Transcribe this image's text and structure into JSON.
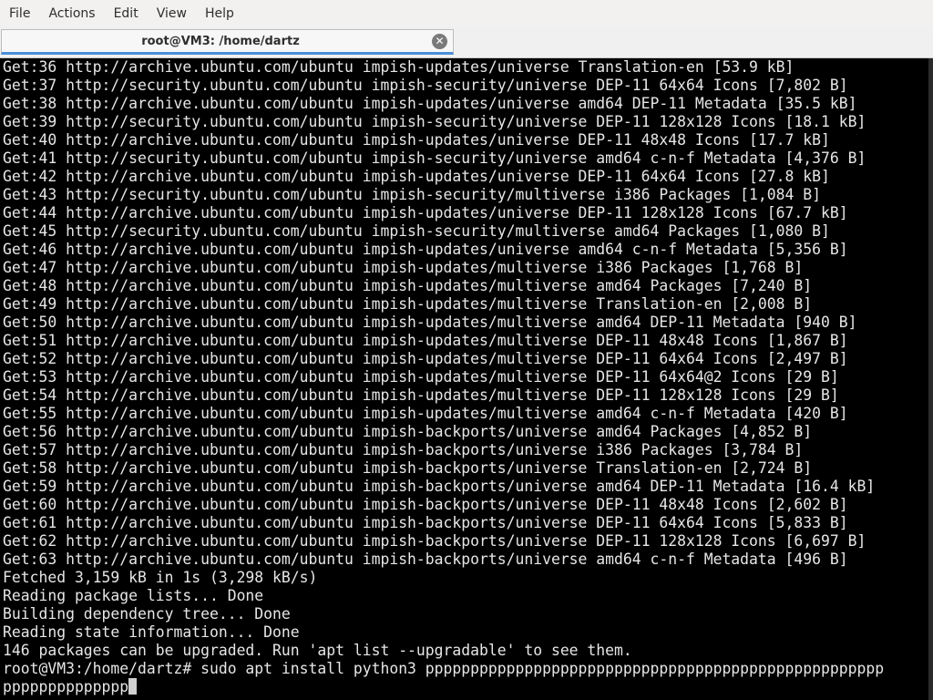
{
  "menubar": {
    "items": [
      "File",
      "Actions",
      "Edit",
      "View",
      "Help"
    ]
  },
  "tab": {
    "title": "root@VM3: /home/dartz",
    "close_icon": "close-icon"
  },
  "terminal": {
    "background": "#000000",
    "foreground": "#e6e6e6",
    "lines": [
      "Get:36 http://archive.ubuntu.com/ubuntu impish-updates/universe Translation-en [53.9 kB]",
      "Get:37 http://security.ubuntu.com/ubuntu impish-security/universe DEP-11 64x64 Icons [7,802 B]",
      "Get:38 http://archive.ubuntu.com/ubuntu impish-updates/universe amd64 DEP-11 Metadata [35.5 kB]",
      "Get:39 http://security.ubuntu.com/ubuntu impish-security/universe DEP-11 128x128 Icons [18.1 kB]",
      "Get:40 http://archive.ubuntu.com/ubuntu impish-updates/universe DEP-11 48x48 Icons [17.7 kB]",
      "Get:41 http://security.ubuntu.com/ubuntu impish-security/universe amd64 c-n-f Metadata [4,376 B]",
      "Get:42 http://archive.ubuntu.com/ubuntu impish-updates/universe DEP-11 64x64 Icons [27.8 kB]",
      "Get:43 http://security.ubuntu.com/ubuntu impish-security/multiverse i386 Packages [1,084 B]",
      "Get:44 http://archive.ubuntu.com/ubuntu impish-updates/universe DEP-11 128x128 Icons [67.7 kB]",
      "Get:45 http://security.ubuntu.com/ubuntu impish-security/multiverse amd64 Packages [1,080 B]",
      "Get:46 http://archive.ubuntu.com/ubuntu impish-updates/universe amd64 c-n-f Metadata [5,356 B]",
      "Get:47 http://archive.ubuntu.com/ubuntu impish-updates/multiverse i386 Packages [1,768 B]",
      "Get:48 http://archive.ubuntu.com/ubuntu impish-updates/multiverse amd64 Packages [7,240 B]",
      "Get:49 http://archive.ubuntu.com/ubuntu impish-updates/multiverse Translation-en [2,008 B]",
      "Get:50 http://archive.ubuntu.com/ubuntu impish-updates/multiverse amd64 DEP-11 Metadata [940 B]",
      "Get:51 http://archive.ubuntu.com/ubuntu impish-updates/multiverse DEP-11 48x48 Icons [1,867 B]",
      "Get:52 http://archive.ubuntu.com/ubuntu impish-updates/multiverse DEP-11 64x64 Icons [2,497 B]",
      "Get:53 http://archive.ubuntu.com/ubuntu impish-updates/multiverse DEP-11 64x64@2 Icons [29 B]",
      "Get:54 http://archive.ubuntu.com/ubuntu impish-updates/multiverse DEP-11 128x128 Icons [29 B]",
      "Get:55 http://archive.ubuntu.com/ubuntu impish-updates/multiverse amd64 c-n-f Metadata [420 B]",
      "Get:56 http://archive.ubuntu.com/ubuntu impish-backports/universe amd64 Packages [4,852 B]",
      "Get:57 http://archive.ubuntu.com/ubuntu impish-backports/universe i386 Packages [3,784 B]",
      "Get:58 http://archive.ubuntu.com/ubuntu impish-backports/universe Translation-en [2,724 B]",
      "Get:59 http://archive.ubuntu.com/ubuntu impish-backports/universe amd64 DEP-11 Metadata [16.4 kB]",
      "Get:60 http://archive.ubuntu.com/ubuntu impish-backports/universe DEP-11 48x48 Icons [2,602 B]",
      "Get:61 http://archive.ubuntu.com/ubuntu impish-backports/universe DEP-11 64x64 Icons [5,833 B]",
      "Get:62 http://archive.ubuntu.com/ubuntu impish-backports/universe DEP-11 128x128 Icons [6,697 B]",
      "Get:63 http://archive.ubuntu.com/ubuntu impish-backports/universe amd64 c-n-f Metadata [496 B]",
      "Fetched 3,159 kB in 1s (3,298 kB/s)",
      "Reading package lists... Done",
      "Building dependency tree... Done",
      "Reading state information... Done",
      "146 packages can be upgraded. Run 'apt list --upgradable' to see them.",
      "root@VM3:/home/dartz# sudo apt install python3 ppppppppppppppppppppppppppppppppppppppppppppppppppp"
    ],
    "input_continuation": "pppppppppppppp"
  }
}
